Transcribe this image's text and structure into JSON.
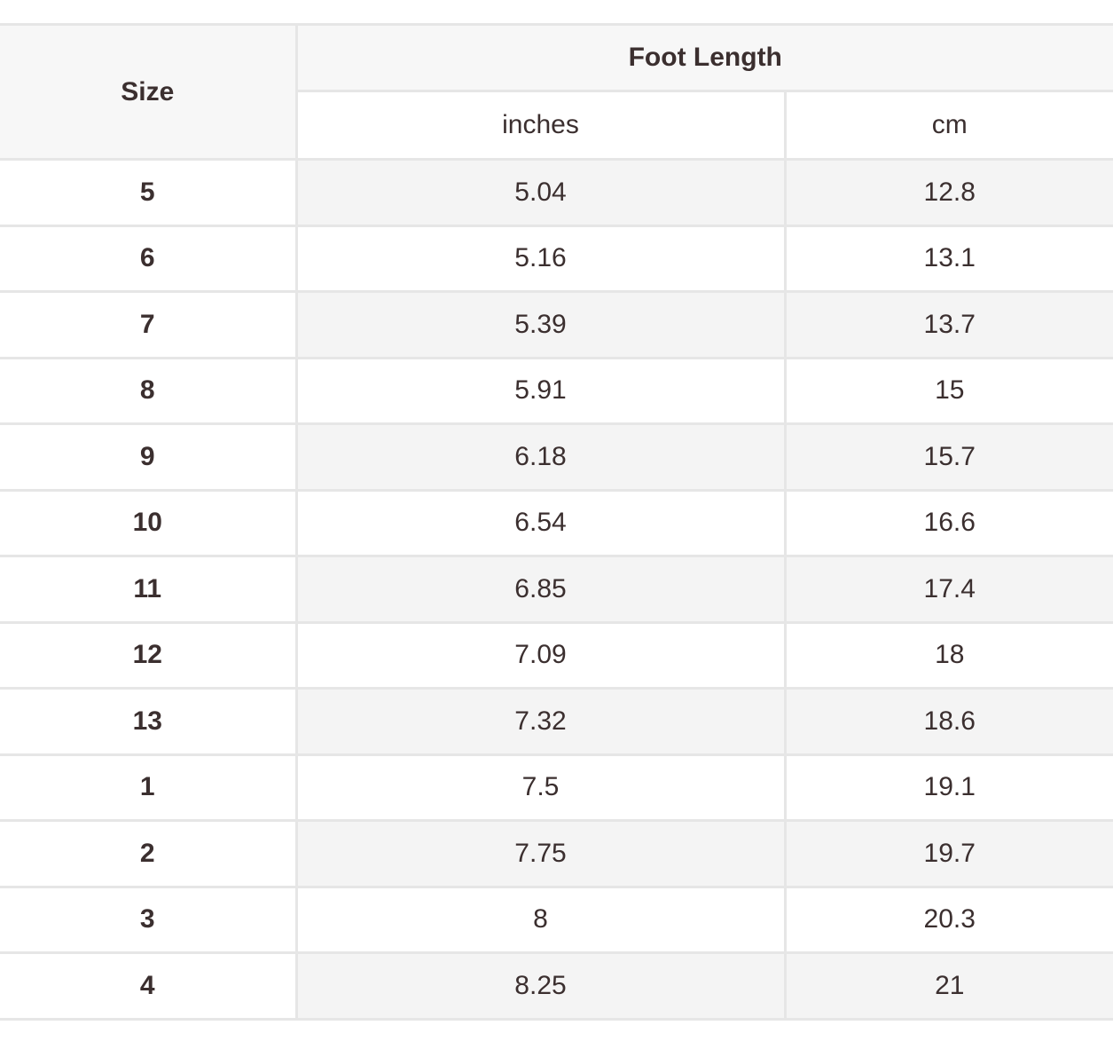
{
  "table": {
    "size_header": "Size",
    "group_header": "Foot Length",
    "unit_inches": "inches",
    "unit_cm": "cm",
    "rows": [
      {
        "size": "5",
        "inches": "5.04",
        "cm": "12.8"
      },
      {
        "size": "6",
        "inches": "5.16",
        "cm": "13.1"
      },
      {
        "size": "7",
        "inches": "5.39",
        "cm": "13.7"
      },
      {
        "size": "8",
        "inches": "5.91",
        "cm": "15"
      },
      {
        "size": "9",
        "inches": "6.18",
        "cm": "15.7"
      },
      {
        "size": "10",
        "inches": "6.54",
        "cm": "16.6"
      },
      {
        "size": "11",
        "inches": "6.85",
        "cm": "17.4"
      },
      {
        "size": "12",
        "inches": "7.09",
        "cm": "18"
      },
      {
        "size": "13",
        "inches": "7.32",
        "cm": "18.6"
      },
      {
        "size": "1",
        "inches": "7.5",
        "cm": "19.1"
      },
      {
        "size": "2",
        "inches": "7.75",
        "cm": "19.7"
      },
      {
        "size": "3",
        "inches": "8",
        "cm": "20.3"
      },
      {
        "size": "4",
        "inches": "8.25",
        "cm": "21"
      }
    ]
  }
}
